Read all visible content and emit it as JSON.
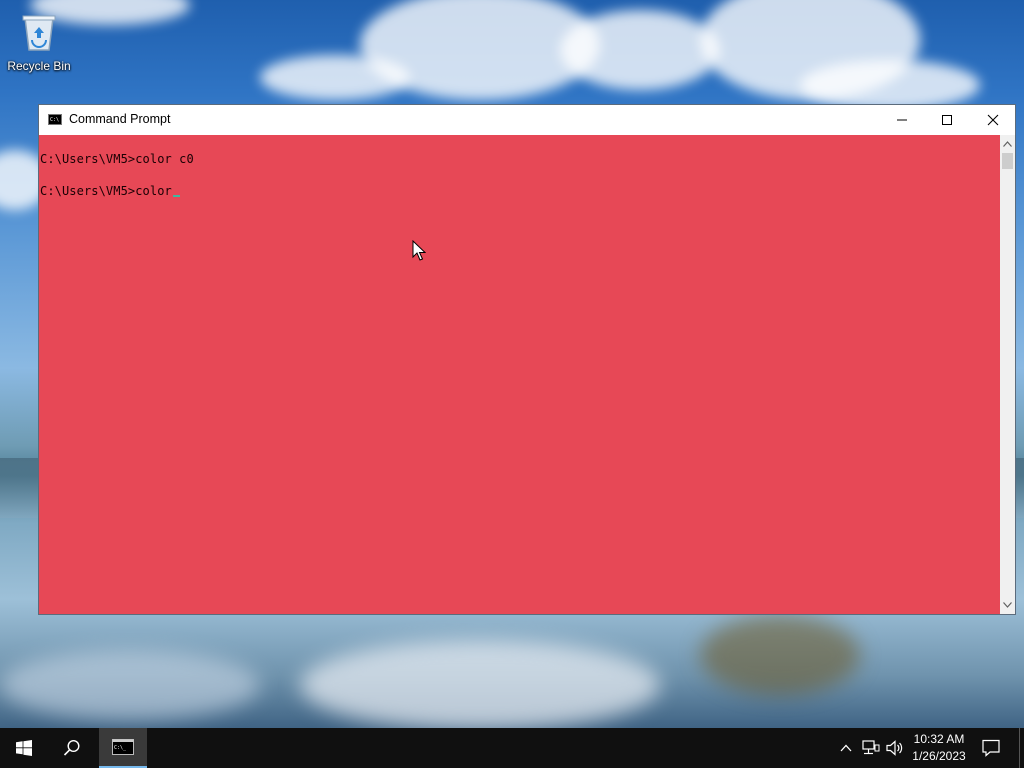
{
  "desktop": {
    "icons": [
      {
        "label": "Recycle Bin",
        "icon": "recycle-bin-icon"
      }
    ]
  },
  "window": {
    "title": "Command Prompt",
    "icon": "cmd-icon",
    "console_background": "#e74856",
    "console_foreground": "#1a0004",
    "lines": [
      "C:\\Users\\VM5>color c0",
      "C:\\Users\\VM5>color"
    ],
    "controls": [
      "minimize-icon",
      "maximize-icon",
      "close-icon"
    ]
  },
  "taskbar": {
    "start_icon": "windows-logo-icon",
    "search_icon": "search-icon",
    "pinned": [
      {
        "name": "Command Prompt",
        "icon": "cmd-icon",
        "active": true
      }
    ],
    "tray": {
      "icons": [
        "chevron-up-icon",
        "network-icon",
        "volume-icon"
      ],
      "time": "10:32 AM",
      "date": "1/26/2023",
      "action_center_icon": "notification-icon"
    }
  }
}
